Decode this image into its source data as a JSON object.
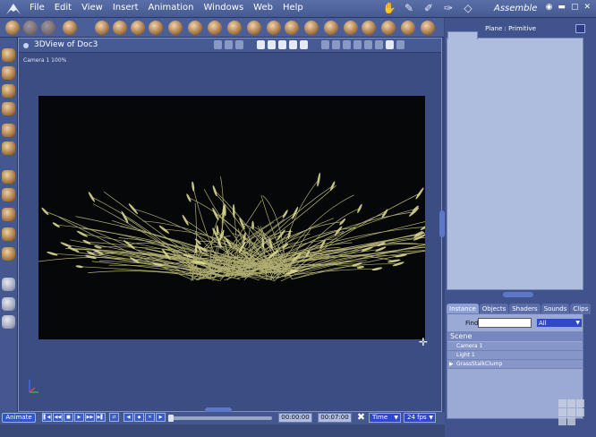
{
  "menu": {
    "items": [
      "File",
      "Edit",
      "View",
      "Insert",
      "Animation",
      "Windows",
      "Web",
      "Help"
    ],
    "room_title": "Assemble"
  },
  "view": {
    "title": "3DView of Doc3",
    "camera_label": "Camera 1 100%"
  },
  "params": {
    "title": "Plane : Primitive"
  },
  "browser": {
    "tabs": [
      "Instance",
      "Objects",
      "Shaders",
      "Sounds",
      "Clips"
    ],
    "find_label": "Find",
    "find_value": "",
    "filter_value": "All",
    "scene_header": "Scene",
    "scene_items": [
      "Camera 1",
      "Light 1",
      "GrassStalkClump"
    ]
  },
  "transport": {
    "animate_label": "Animate",
    "current_time": "00:00:00",
    "end_time": "00:07:00",
    "time_mode": "Time",
    "fps": "24 fps"
  },
  "colors": {
    "render_bg": "#050708",
    "grass": "#d7d38a",
    "accent": "#3048c8"
  }
}
